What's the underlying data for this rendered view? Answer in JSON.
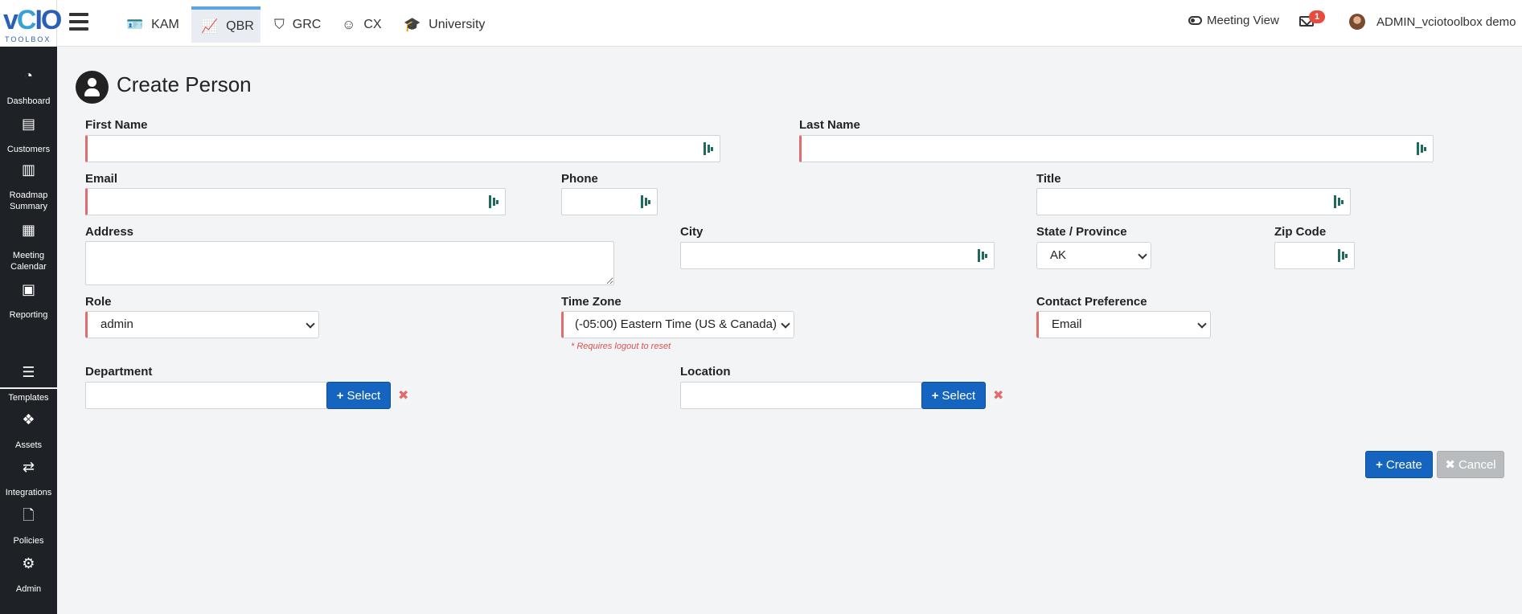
{
  "brand": {
    "logo_big": "vCIO",
    "logo_small": "TOOLBOX"
  },
  "topnav": {
    "tabs": [
      {
        "label": "KAM",
        "icon": "id-card-icon"
      },
      {
        "label": "QBR",
        "icon": "chart-line-icon"
      },
      {
        "label": "GRC",
        "icon": "shield-icon"
      },
      {
        "label": "CX",
        "icon": "smile-icon"
      },
      {
        "label": "University",
        "icon": "graduation-cap-icon"
      }
    ],
    "active_tab": "QBR",
    "meeting_view": "Meeting View",
    "mail_badge": "1",
    "user_name": "ADMIN_vciotoolbox demo"
  },
  "sidebar": {
    "items": [
      {
        "label": "Dashboard",
        "icon": "tachometer-icon"
      },
      {
        "label": "Customers",
        "icon": "address-card-icon"
      },
      {
        "label": "Roadmap Summary",
        "icon": "map-icon"
      },
      {
        "label": "Meeting Calendar",
        "icon": "calendar-icon"
      },
      {
        "label": "Reporting",
        "icon": "newspaper-icon"
      },
      {
        "label": "Templates",
        "icon": "layers-icon"
      },
      {
        "label": "Assets",
        "icon": "cubes-icon"
      },
      {
        "label": "Integrations",
        "icon": "shuffle-icon"
      },
      {
        "label": "Policies",
        "icon": "file-icon"
      },
      {
        "label": "Admin",
        "icon": "cogs-icon"
      }
    ]
  },
  "form": {
    "title": "Create Person",
    "first_name": {
      "label": "First Name",
      "value": ""
    },
    "last_name": {
      "label": "Last Name",
      "value": ""
    },
    "email": {
      "label": "Email",
      "value": ""
    },
    "phone": {
      "label": "Phone",
      "value": ""
    },
    "title_field": {
      "label": "Title",
      "value": ""
    },
    "address": {
      "label": "Address",
      "value": ""
    },
    "city": {
      "label": "City",
      "value": ""
    },
    "state": {
      "label": "State / Province",
      "value": "AK"
    },
    "zip": {
      "label": "Zip Code",
      "value": ""
    },
    "role": {
      "label": "Role",
      "value": "admin"
    },
    "timezone": {
      "label": "Time Zone",
      "value": "(-05:00) Eastern Time (US & Canada)",
      "note": "* Requires logout to reset"
    },
    "contact_pref": {
      "label": "Contact Preference",
      "value": "Email"
    },
    "department": {
      "label": "Department",
      "value": "",
      "select_label": "Select"
    },
    "location": {
      "label": "Location",
      "value": "",
      "select_label": "Select"
    },
    "create_label": "Create",
    "cancel_label": "Cancel"
  },
  "colors": {
    "primary": "#1565c0",
    "sidebar_bg": "#1e2227",
    "required": "#e26b6b",
    "badge": "#e74c3c"
  }
}
